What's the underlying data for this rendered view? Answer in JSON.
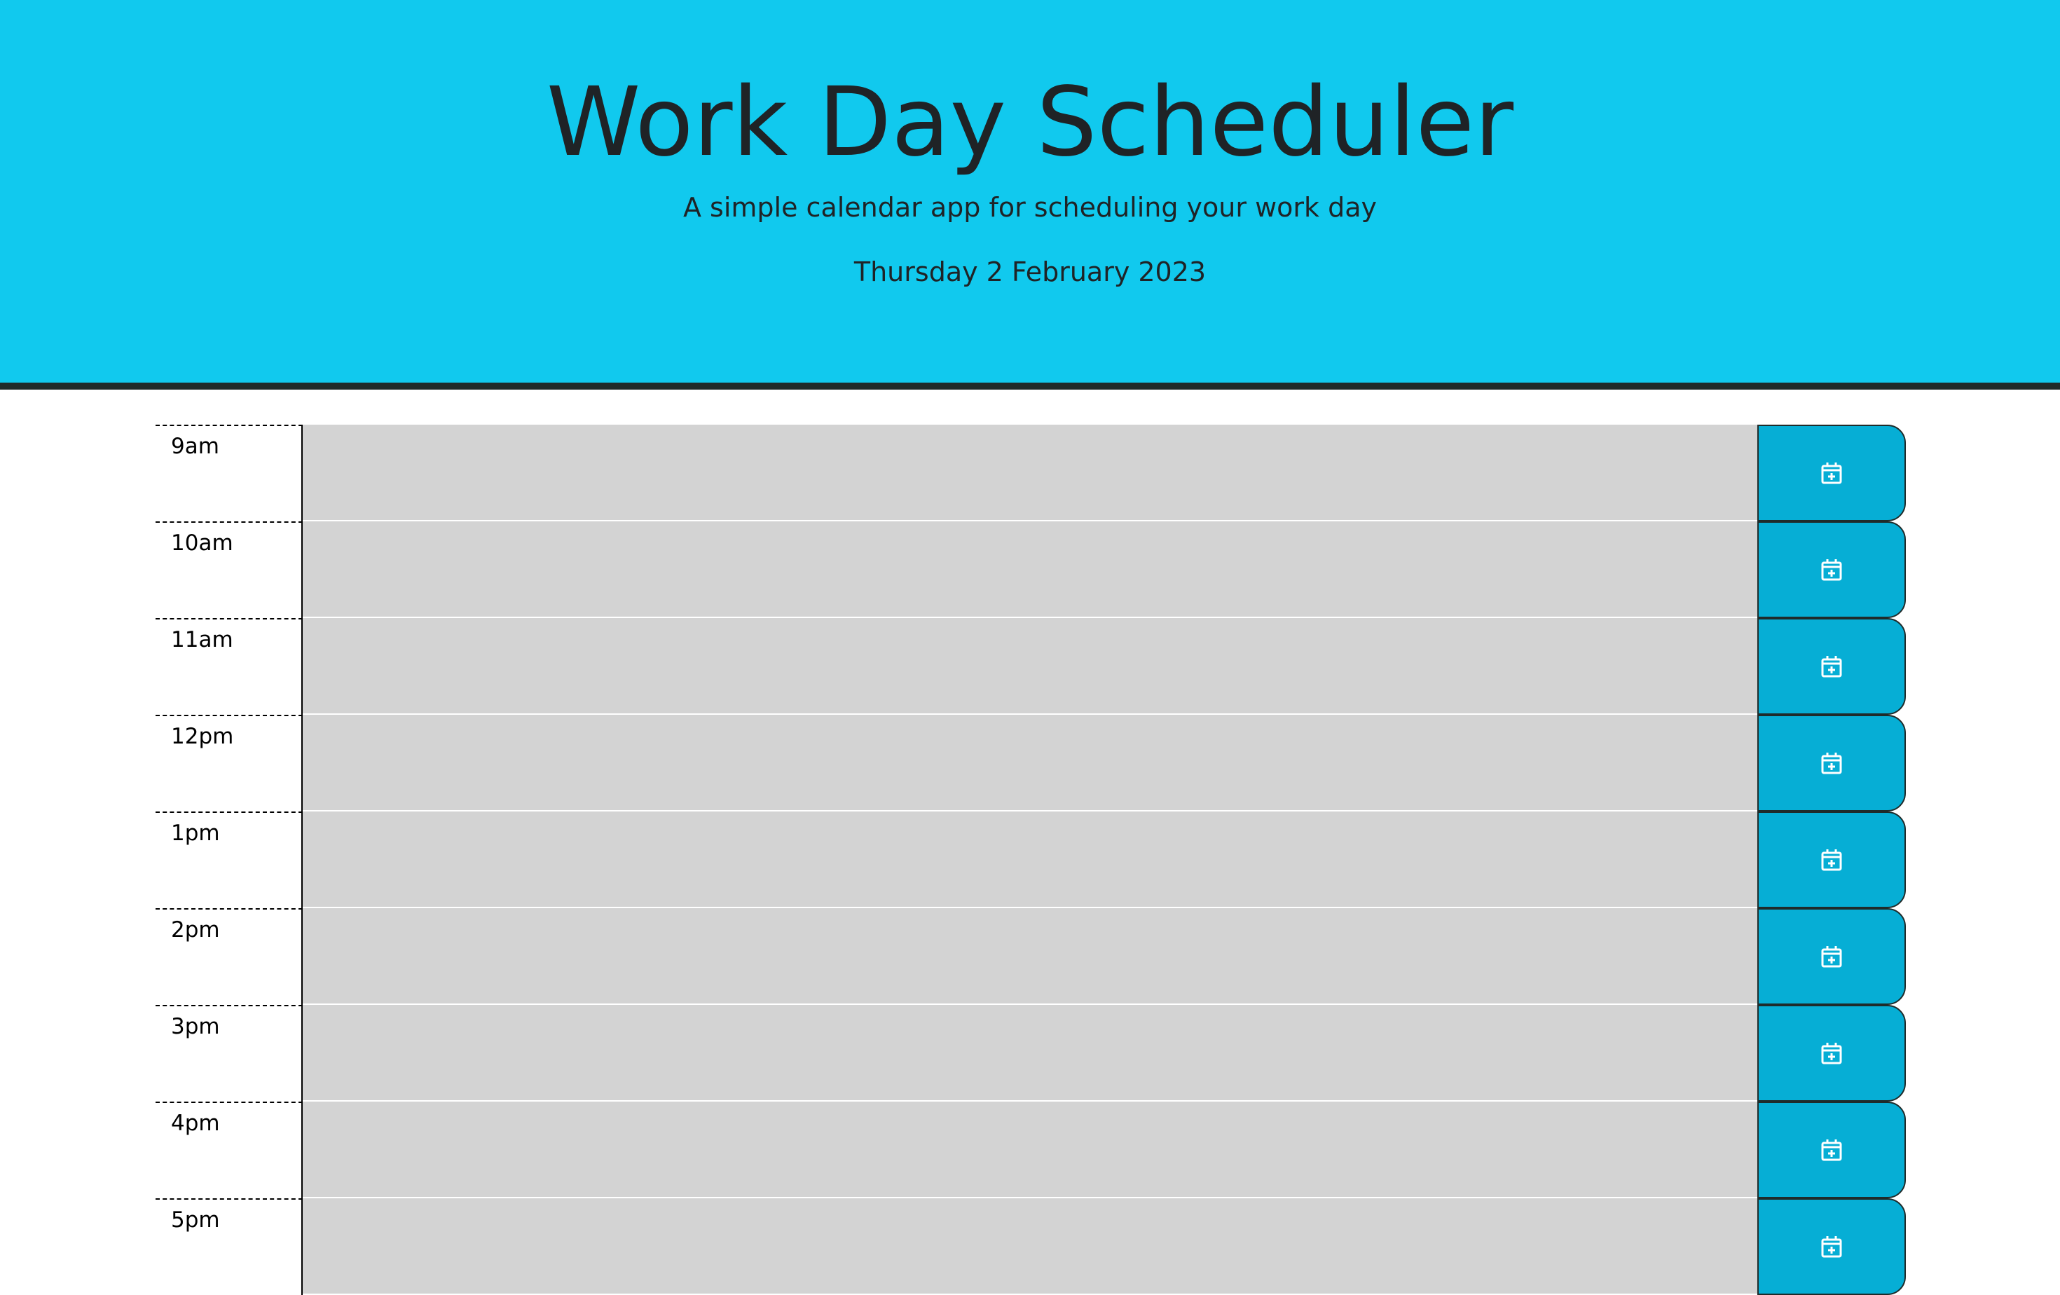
{
  "header": {
    "title": "Work Day Scheduler",
    "subtitle": "A simple calendar app for scheduling your work day",
    "current_date": "Thursday 2 February 2023"
  },
  "colors": {
    "header_bg": "#11c9ee",
    "header_border": "#1f2b2a",
    "description_bg": "#d3d3d3",
    "save_button_bg": "#06aed5",
    "save_icon": "#ffffff"
  },
  "time_blocks": [
    {
      "hour_label": "9am",
      "description": "",
      "save_icon": "calendar-plus-icon"
    },
    {
      "hour_label": "10am",
      "description": "",
      "save_icon": "calendar-plus-icon"
    },
    {
      "hour_label": "11am",
      "description": "",
      "save_icon": "calendar-plus-icon"
    },
    {
      "hour_label": "12pm",
      "description": "",
      "save_icon": "calendar-plus-icon"
    },
    {
      "hour_label": "1pm",
      "description": "",
      "save_icon": "calendar-plus-icon"
    },
    {
      "hour_label": "2pm",
      "description": "",
      "save_icon": "calendar-plus-icon"
    },
    {
      "hour_label": "3pm",
      "description": "",
      "save_icon": "calendar-plus-icon"
    },
    {
      "hour_label": "4pm",
      "description": "",
      "save_icon": "calendar-plus-icon"
    },
    {
      "hour_label": "5pm",
      "description": "",
      "save_icon": "calendar-plus-icon"
    }
  ]
}
